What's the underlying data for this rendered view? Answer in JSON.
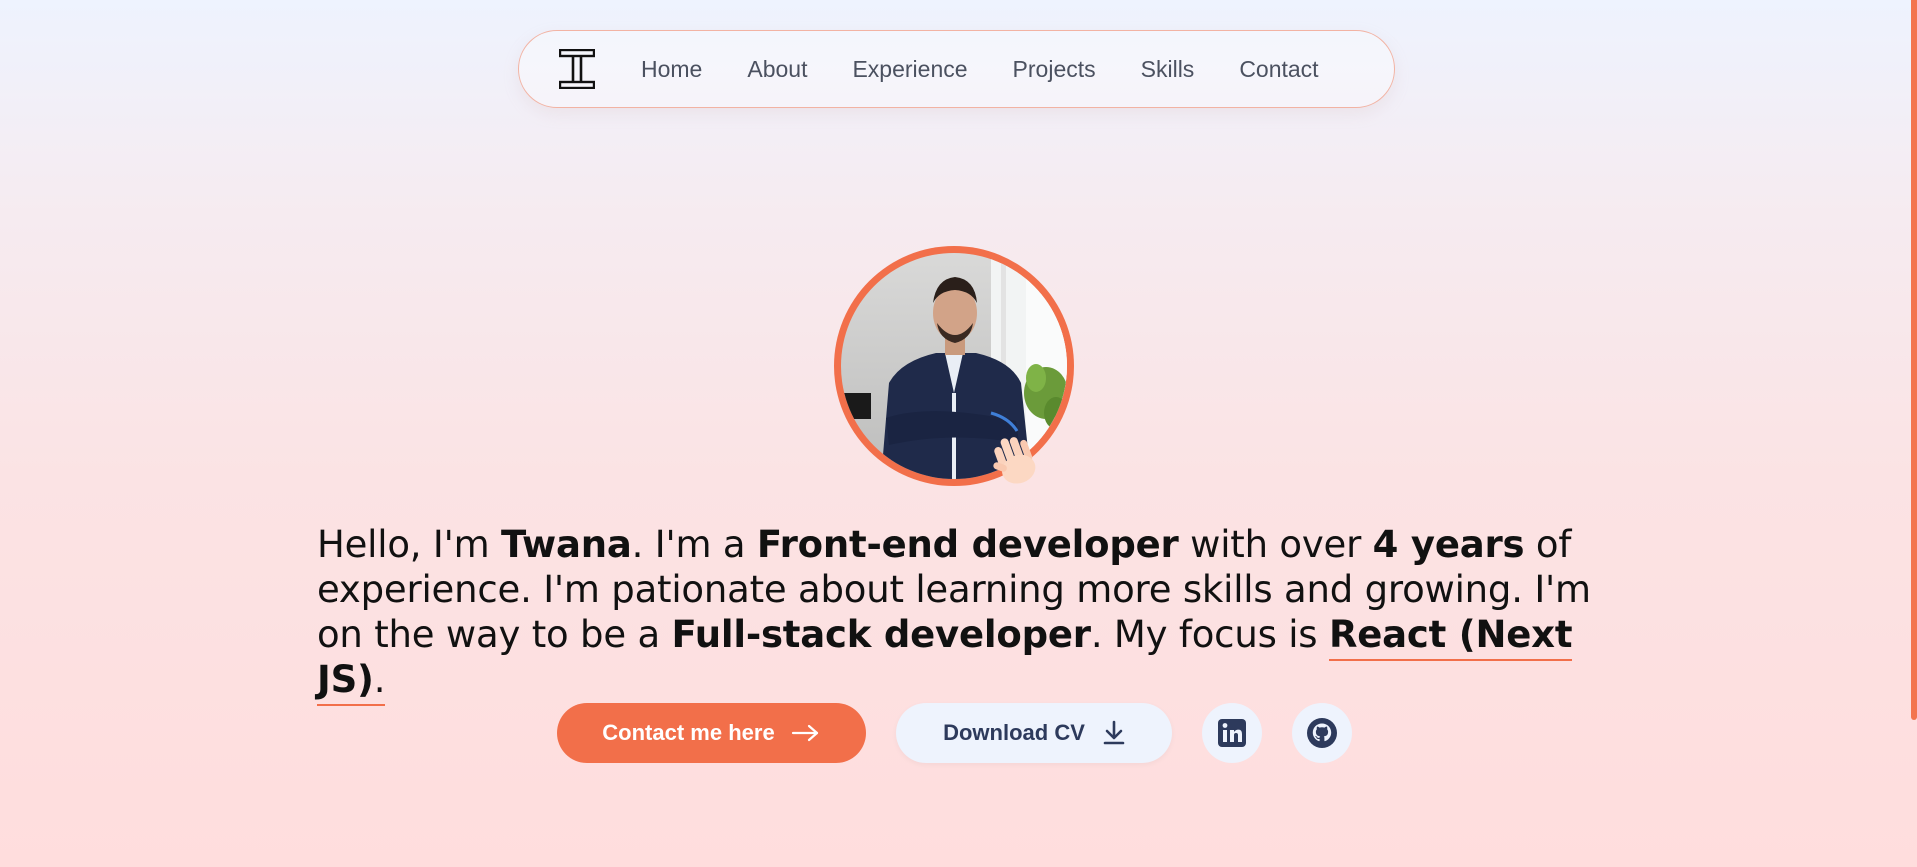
{
  "nav": {
    "logo": "logo-icon",
    "links": [
      "Home",
      "About",
      "Experience",
      "Projects",
      "Skills",
      "Contact"
    ]
  },
  "hero": {
    "avatar": "profile-photo",
    "wave": "waving-hand-icon",
    "intro": {
      "t1": "Hello, I'm ",
      "name": "Twana",
      "t2": ". I'm a ",
      "role": "Front-end developer",
      "t3": " with over ",
      "years": "4 years",
      "t4": " of experience. I'm pationate about learning more skills and growing. I'm on the way to be a ",
      "goal": "Full-stack developer",
      "t5": ". My focus is ",
      "focus": "React (Next JS)",
      "t6": "."
    }
  },
  "actions": {
    "contact_label": "Contact me here",
    "contact_icon": "arrow-right-icon",
    "cv_label": "Download CV",
    "cv_icon": "download-icon",
    "linkedin_icon": "linkedin-icon",
    "github_icon": "github-icon"
  },
  "colors": {
    "accent": "#f26f4a",
    "navy": "#2d3a5c",
    "button_light": "#eef3fd"
  }
}
